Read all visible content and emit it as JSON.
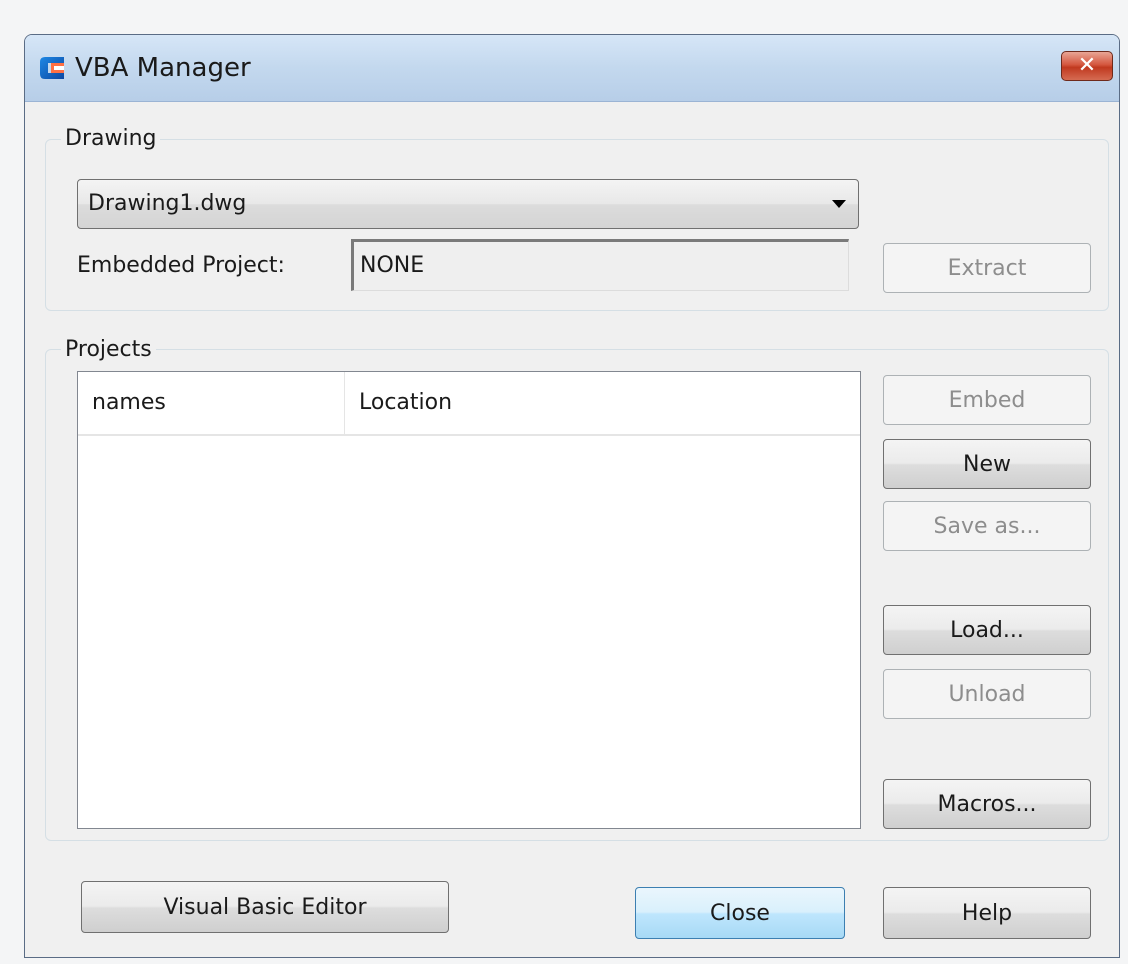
{
  "window": {
    "title": "VBA Manager",
    "close_glyph": "✕",
    "app_icon": "app-logo-icon"
  },
  "drawing_group": {
    "legend": "Drawing",
    "selected_drawing": "Drawing1.dwg",
    "embedded_project_label": "Embedded Project:",
    "embedded_project_value": "NONE",
    "extract_label": "Extract"
  },
  "projects_group": {
    "legend": "Projects",
    "columns": [
      "names",
      "Location"
    ],
    "rows": [],
    "embed_label": "Embed",
    "new_label": "New",
    "save_as_label": "Save as...",
    "load_label": "Load...",
    "unload_label": "Unload",
    "macros_label": "Macros..."
  },
  "footer": {
    "vbe_label": "Visual Basic Editor",
    "close_label": "Close",
    "help_label": "Help"
  },
  "colors": {
    "titlebar": "#c3d8ee",
    "close_button": "#c0391f",
    "default_button": "#bee6fd"
  }
}
